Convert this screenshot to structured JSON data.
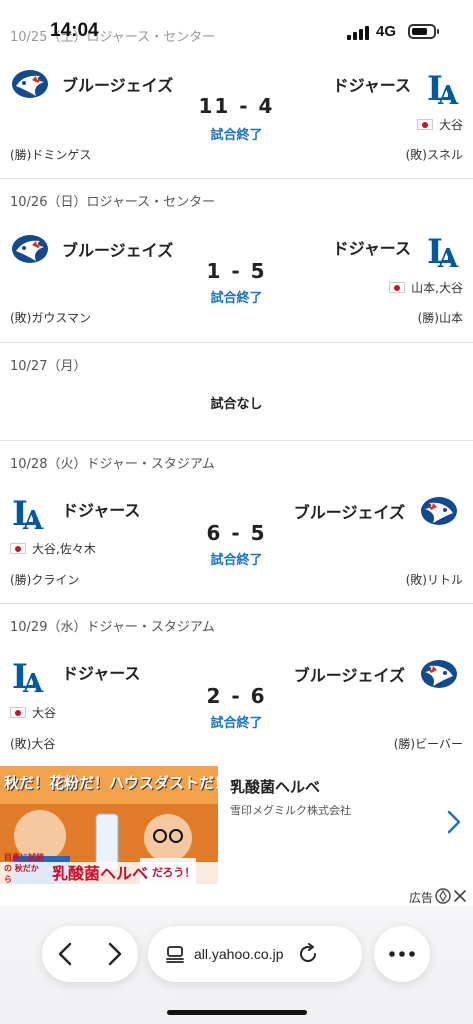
{
  "status_bar": {
    "time": "14:04",
    "network": "4G"
  },
  "games": [
    {
      "header": "10/25（土）ロジャース・センター",
      "left_team": "ブルージェイズ",
      "right_team": "ドジャース",
      "score": "11 - 4",
      "status": "試合終了",
      "right_players": "大谷",
      "left_pitcher": "(勝)ドミンゲス",
      "right_pitcher": "(敗)スネル"
    },
    {
      "header": "10/26（日）ロジャース・センター",
      "left_team": "ブルージェイズ",
      "right_team": "ドジャース",
      "score": "1 - 5",
      "status": "試合終了",
      "right_players": "山本,大谷",
      "left_pitcher": "(敗)ガウスマン",
      "right_pitcher": "(勝)山本"
    },
    {
      "header": "10/27（月）",
      "no_game": "試合なし"
    },
    {
      "header": "10/28（火）ドジャー・スタジアム",
      "left_team": "ドジャース",
      "right_team": "ブルージェイズ",
      "score": "6 - 5",
      "status": "試合終了",
      "left_players": "大谷,佐々木",
      "left_pitcher": "(勝)クライン",
      "right_pitcher": "(敗)リトル"
    },
    {
      "header": "10/29（水）ドジャー・スタジアム",
      "left_team": "ドジャース",
      "right_team": "ブルージェイズ",
      "score": "2 - 6",
      "status": "試合終了",
      "left_players": "大谷",
      "left_pitcher": "(敗)大谷",
      "right_pitcher": "(勝)ビーバー"
    }
  ],
  "ad": {
    "banner_text_1": "秋だ！花粉だ！ハウスダストだ！",
    "banner_text_2": "乳酸菌ヘルベ",
    "banner_text_3": "だろう！",
    "banner_small": "目鼻に試練の 秋だから",
    "title": "乳酸菌ヘルベ",
    "sponsor": "雪印メグミルク株式会社",
    "label": "広告"
  },
  "browser": {
    "url": "all.yahoo.co.jp"
  },
  "colors": {
    "accent": "#1a73c9",
    "dodgers": "#005a9c",
    "bluejays": "#134a8e",
    "flag_red": "#c8102e"
  }
}
